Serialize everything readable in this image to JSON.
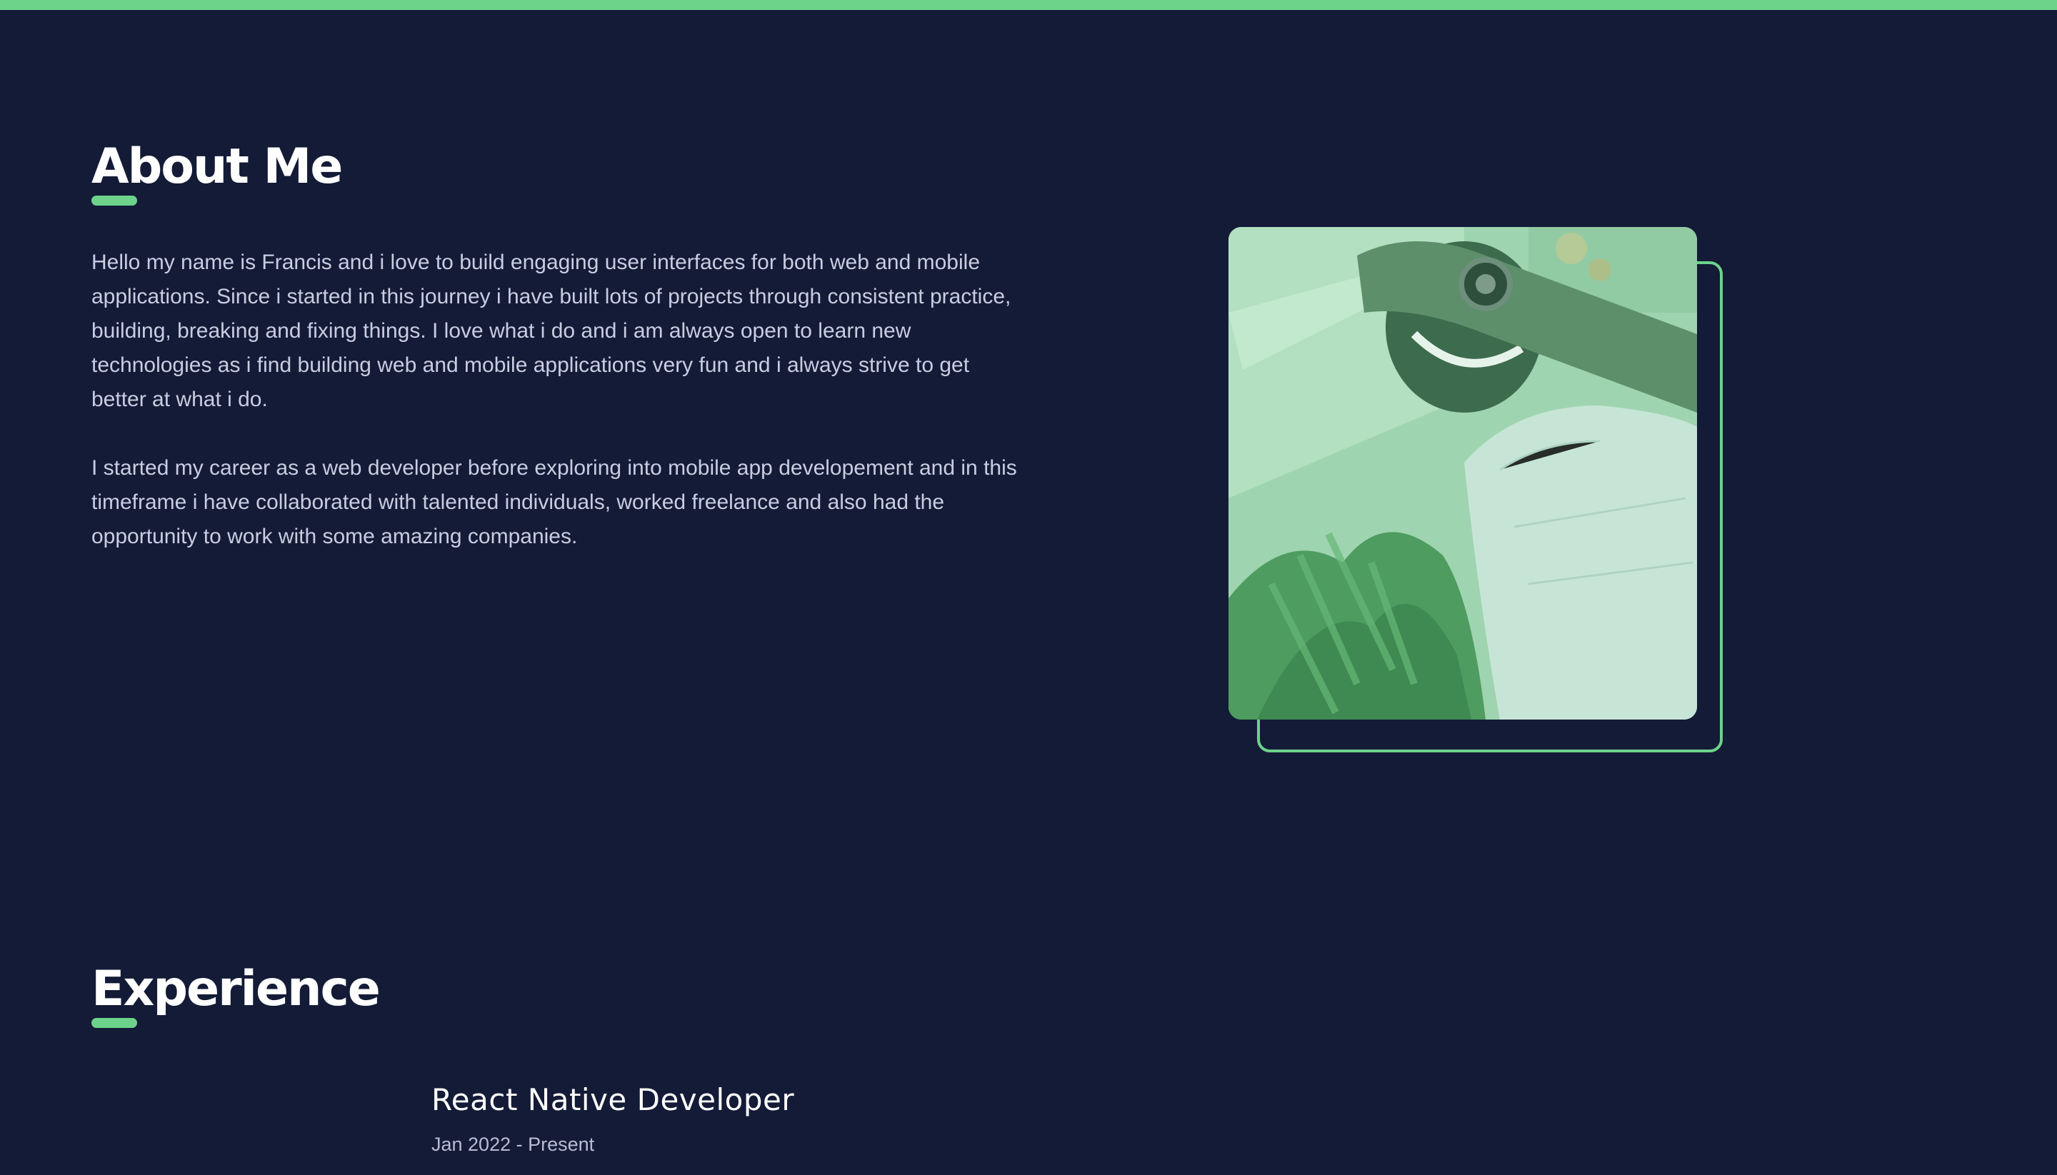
{
  "theme": {
    "background": "#141b37",
    "accent": "#6dd38b",
    "heading": "#ffffff",
    "body_text": "#c9cde0"
  },
  "about": {
    "title": "About Me",
    "paragraphs": [
      "Hello my name is Francis and i love to build engaging user interfaces for both web and mobile applications. Since i started in this journey i have built lots of projects through consistent practice, building, breaking and fixing things. I love what i do and i am always open to learn new technologies as i find building web and mobile applications very fun and i always strive to get better at what i do.",
      "I started my career as a web developer before exploring into mobile app developement and in this timeframe i have collaborated with talented individuals, worked freelance and also had the opportunity to work with some amazing companies."
    ]
  },
  "experience": {
    "title": "Experience",
    "jobs": [
      {
        "role": "React Native Developer",
        "dates": "Jan 2022 - Present"
      }
    ]
  }
}
